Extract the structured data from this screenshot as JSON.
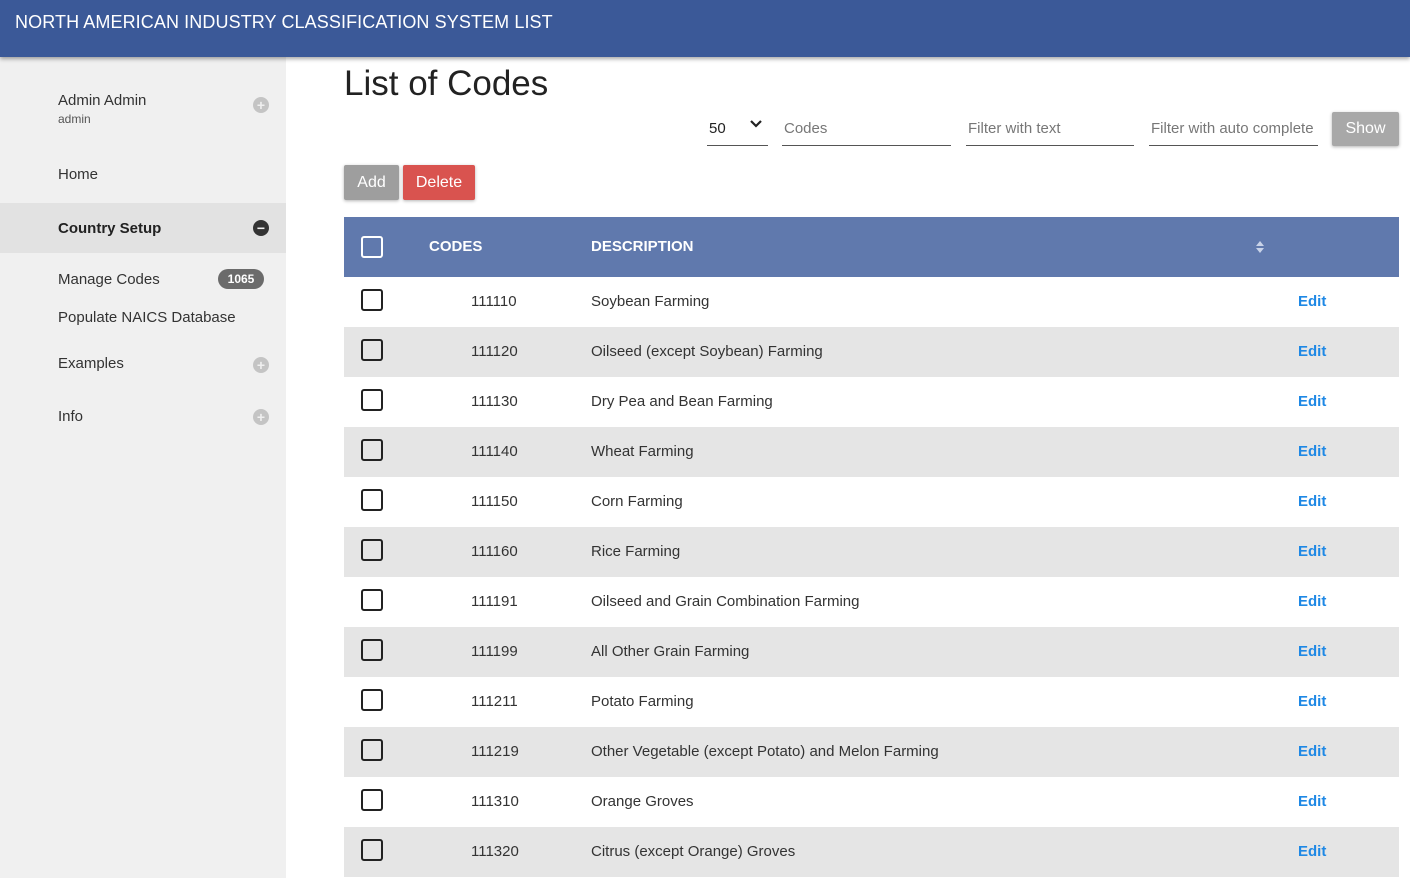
{
  "header": {
    "title": "NORTH AMERICAN INDUSTRY CLASSIFICATION SYSTEM LIST"
  },
  "sidebar": {
    "user": {
      "name": "Admin Admin",
      "login": "admin"
    },
    "items": [
      {
        "label": "Home"
      },
      {
        "label": "Country Setup"
      },
      {
        "label": "Manage Codes",
        "badge": "1065"
      },
      {
        "label": "Populate NAICS Database"
      },
      {
        "label": "Examples"
      },
      {
        "label": "Info"
      }
    ]
  },
  "main": {
    "title": "List of Codes",
    "filters": {
      "page_size": "50",
      "codes_placeholder": "Codes",
      "text_placeholder": "Filter with text",
      "autocomplete_placeholder": "Filter with auto complete",
      "show_label": "Show"
    },
    "actions": {
      "add_label": "Add",
      "delete_label": "Delete"
    },
    "table": {
      "columns": {
        "codes": "CODES",
        "description": "DESCRIPTION"
      },
      "edit_label": "Edit",
      "rows": [
        {
          "code": "111110",
          "description": "Soybean Farming"
        },
        {
          "code": "111120",
          "description": "Oilseed (except Soybean) Farming"
        },
        {
          "code": "111130",
          "description": "Dry Pea and Bean Farming"
        },
        {
          "code": "111140",
          "description": "Wheat Farming"
        },
        {
          "code": "111150",
          "description": "Corn Farming"
        },
        {
          "code": "111160",
          "description": "Rice Farming"
        },
        {
          "code": "111191",
          "description": "Oilseed and Grain Combination Farming"
        },
        {
          "code": "111199",
          "description": "All Other Grain Farming"
        },
        {
          "code": "111211",
          "description": "Potato Farming"
        },
        {
          "code": "111219",
          "description": "Other Vegetable (except Potato) and Melon Farming"
        },
        {
          "code": "111310",
          "description": "Orange Groves"
        },
        {
          "code": "111320",
          "description": "Citrus (except Orange) Groves"
        }
      ]
    }
  },
  "colors": {
    "topbar": "#3b5998",
    "table_header": "#6079ad",
    "delete": "#d9534f",
    "edit_link": "#1e88e5"
  }
}
